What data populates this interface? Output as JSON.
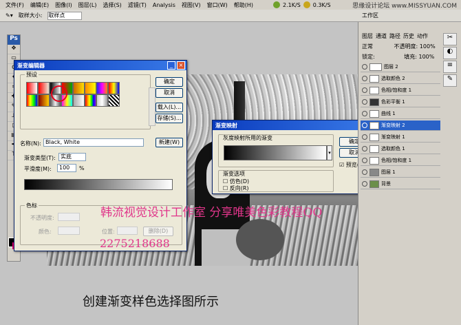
{
  "menubar": {
    "items": [
      "文件(F)",
      "编辑(E)",
      "图像(I)",
      "图层(L)",
      "选择(S)",
      "滤镜(T)",
      "Analysis",
      "视图(V)",
      "窗口(W)",
      "帮助(H)"
    ],
    "status_1": "2.1K/S",
    "status_2": "0.3K/S",
    "site": "思缘设计论坛  www.MISSYUAN.COM"
  },
  "optionsbar": {
    "sample_label": "取样大小:",
    "sample_value": "取样点",
    "workspace": "工作区"
  },
  "toolbox": {
    "logo": "Ps"
  },
  "gradient_editor": {
    "title": "渐变编辑器",
    "presets_label": "预设",
    "ok": "确定",
    "cancel": "取消",
    "load": "载入(L)...",
    "save": "存储(S)...",
    "name_label": "名称(N):",
    "name_value": "Black, White",
    "new": "新建(W)",
    "type_label": "渐变类型(T):",
    "type_value": "实底",
    "smooth_label": "平滑度(M):",
    "smooth_value": "100",
    "smooth_unit": "%",
    "stops_label": "色标",
    "opacity_label": "不透明度:",
    "color_label": "颜色:",
    "location_label": "位置:",
    "delete": "删除(D)"
  },
  "gradient_map": {
    "title": "渐变映射",
    "used_label": "灰度映射所用的渐变",
    "ok": "确定",
    "cancel": "取消",
    "preview": "预览(P)",
    "options_label": "渐变选项",
    "dither": "仿色(D)",
    "reverse": "反向(R)"
  },
  "layers_panel": {
    "tabs": [
      "图层",
      "通道",
      "路径",
      "历史",
      "动作"
    ],
    "blend": "正常",
    "opacity_label": "不透明度:",
    "opacity_value": "100%",
    "lock_label": "锁定:",
    "fill_label": "填充:",
    "fill_value": "100%",
    "layers": [
      {
        "name": "图层 2",
        "selected": false
      },
      {
        "name": "选取颜色 2",
        "selected": false
      },
      {
        "name": "色相/饱和度 1",
        "selected": false
      },
      {
        "name": "色彩平衡 1",
        "selected": false
      },
      {
        "name": "曲线 1",
        "selected": false
      },
      {
        "name": "渐变映射 2",
        "selected": true
      },
      {
        "name": "渐变映射 1",
        "selected": false
      },
      {
        "name": "选取颜色 1",
        "selected": false
      },
      {
        "name": "色相/饱和度 1",
        "selected": false
      },
      {
        "name": "图层 1",
        "selected": false
      },
      {
        "name": "背景",
        "selected": false
      }
    ]
  },
  "watermark": {
    "line1": "韩流视觉设计工作室  分享唯美色彩教程QQ",
    "line2": "2275218688"
  },
  "caption": "创建渐变样色选择图所示",
  "colors": {
    "accent": "#e0358a",
    "titlebar": "#0a3bbd"
  }
}
